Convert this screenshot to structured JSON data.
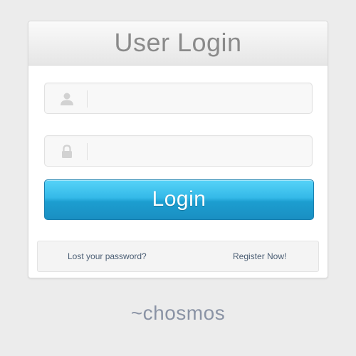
{
  "panel": {
    "title": "User Login"
  },
  "username_field": {
    "icon": "user-icon",
    "value": "",
    "placeholder": ""
  },
  "password_field": {
    "icon": "lock-icon",
    "value": "",
    "placeholder": ""
  },
  "login_button": {
    "label": "Login"
  },
  "footer": {
    "lost_password_label": "Lost your password?",
    "register_label": "Register Now!"
  },
  "signature": "~chosmos",
  "colors": {
    "background": "#ececec",
    "title_text": "#8a8a8a",
    "button_top": "#56d3f8",
    "button_bottom": "#1a8fc2",
    "link_text": "#4b5e74",
    "signature_text": "#8a93a5"
  }
}
